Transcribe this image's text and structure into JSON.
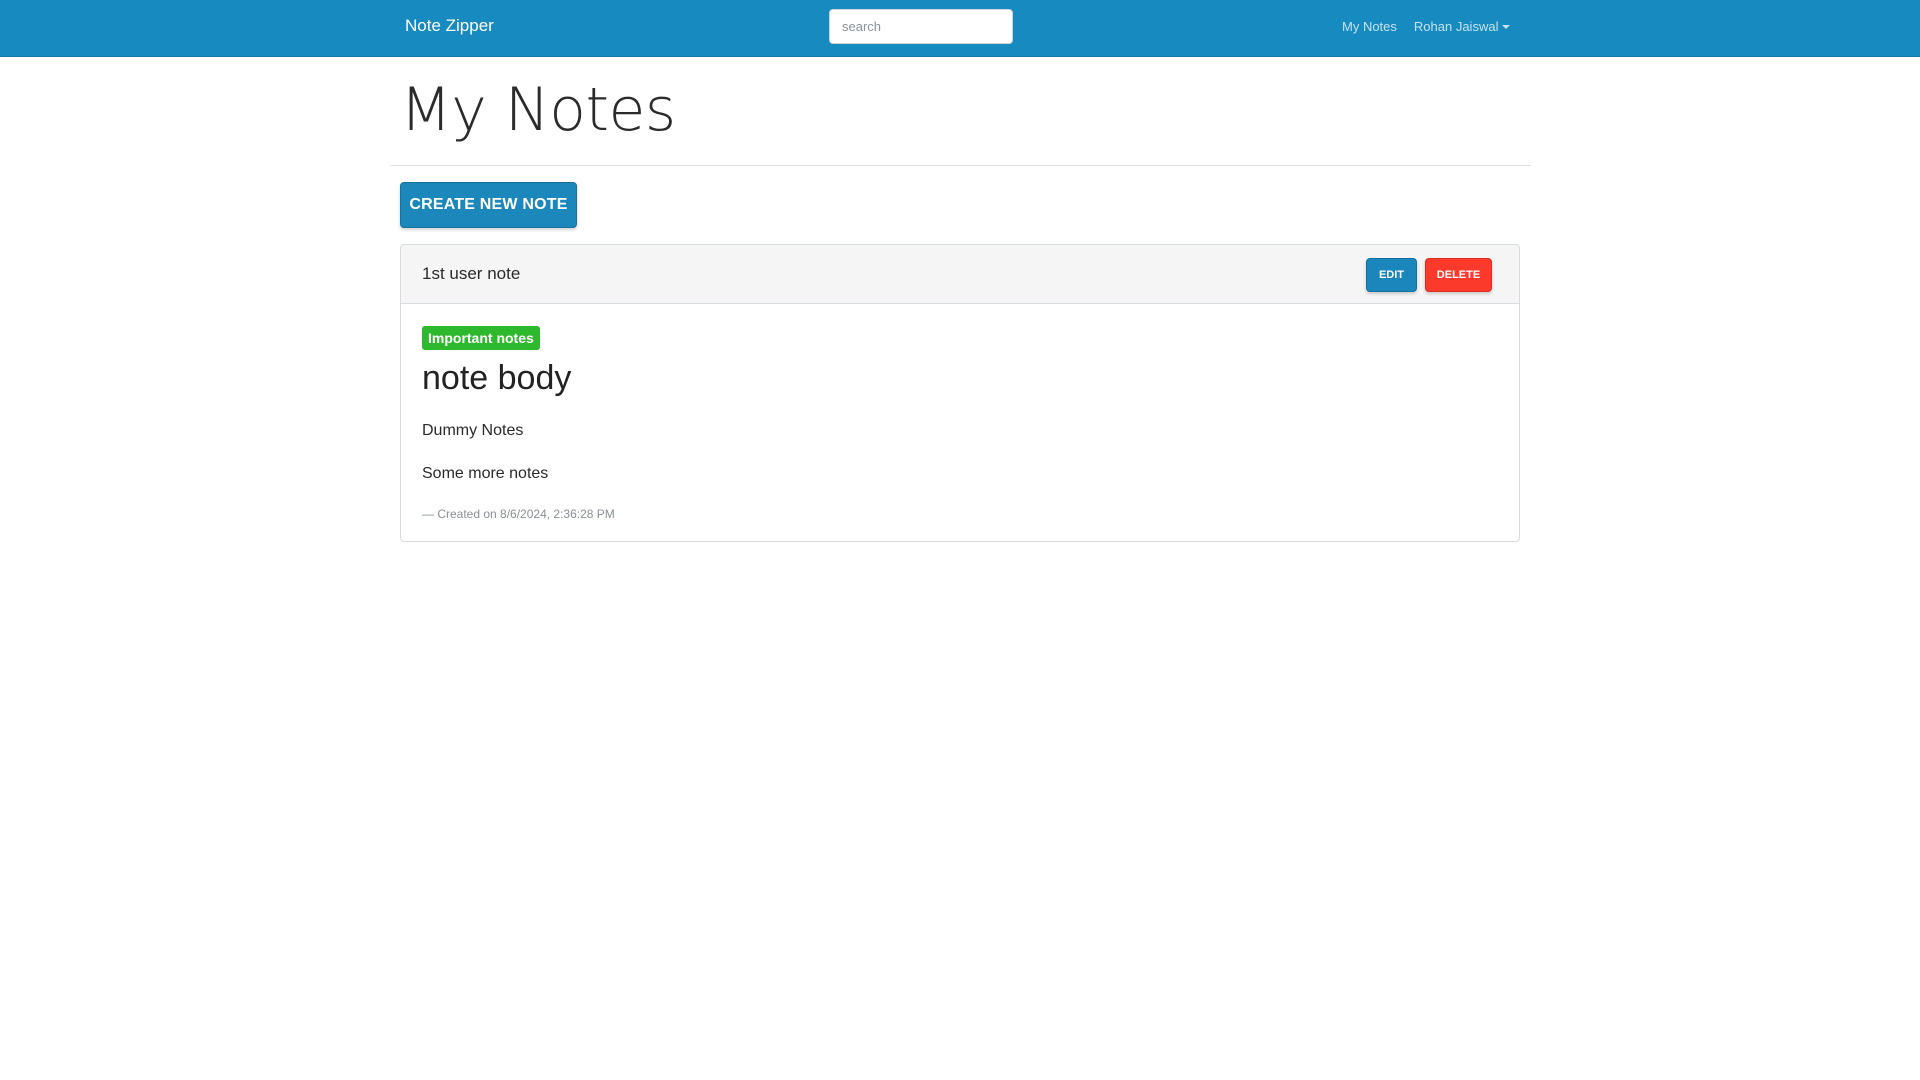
{
  "navbar": {
    "brand": "Note Zipper",
    "search_placeholder": "search",
    "links": {
      "my_notes": "My Notes",
      "user_name": "Rohan Jaiswal"
    }
  },
  "page": {
    "title": "My Notes",
    "create_button_label": "CREATE NEW NOTE"
  },
  "notes": [
    {
      "title": "1st user note",
      "edit_label": "EDIT",
      "delete_label": "DELETE",
      "category": "Important notes",
      "heading": "note body",
      "lines": [
        "Dummy Notes",
        "Some more notes"
      ],
      "footer": "— Created on 8/6/2024, 2:36:28 PM"
    }
  ],
  "colors": {
    "navbar": "#178abf",
    "primary_button": "#1c87bb",
    "danger_button": "#fc3a2b",
    "success_badge": "#2eb82e"
  }
}
